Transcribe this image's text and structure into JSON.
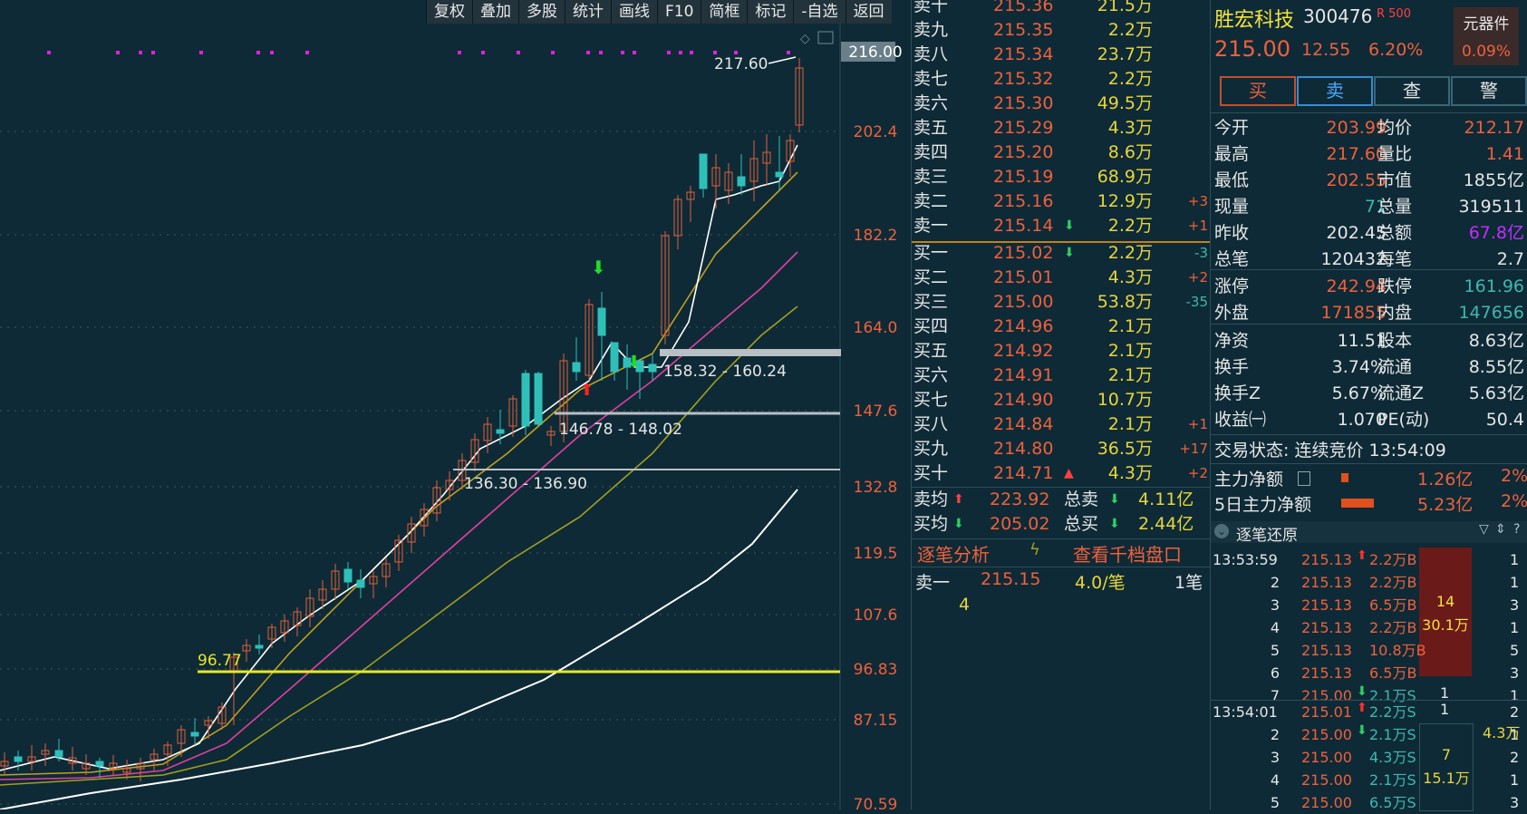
{
  "toolbar": [
    "复权",
    "叠加",
    "多股",
    "统计",
    "画线",
    "F10",
    "简框",
    "标记",
    "-自选",
    "返回"
  ],
  "chart": {
    "price_labels": [
      "216.00",
      "202.4",
      "182.2",
      "164.0",
      "147.6",
      "132.8",
      "119.5",
      "107.6",
      "96.83",
      "87.15",
      "70.59"
    ],
    "annotations": {
      "high": "217.60",
      "zone1": "158.32 - 160.24",
      "zone2": "146.78 - 148.02",
      "zone3": "136.30 - 136.90",
      "support": "96.77"
    }
  },
  "order_book": {
    "sell": [
      {
        "label": "卖十",
        "price": "215.36",
        "vol": "21.5万",
        "chg": ""
      },
      {
        "label": "卖九",
        "price": "215.35",
        "vol": "2.2万",
        "chg": ""
      },
      {
        "label": "卖八",
        "price": "215.34",
        "vol": "23.7万",
        "chg": ""
      },
      {
        "label": "卖七",
        "price": "215.32",
        "vol": "2.2万",
        "chg": ""
      },
      {
        "label": "卖六",
        "price": "215.30",
        "vol": "49.5万",
        "chg": ""
      },
      {
        "label": "卖五",
        "price": "215.29",
        "vol": "4.3万",
        "chg": ""
      },
      {
        "label": "卖四",
        "price": "215.20",
        "vol": "8.6万",
        "chg": ""
      },
      {
        "label": "卖三",
        "price": "215.19",
        "vol": "68.9万",
        "chg": ""
      },
      {
        "label": "卖二",
        "price": "215.16",
        "vol": "12.9万",
        "chg": "+3"
      },
      {
        "label": "卖一",
        "price": "215.14",
        "vol": "2.2万",
        "chg": "+1"
      }
    ],
    "buy": [
      {
        "label": "买一",
        "price": "215.02",
        "vol": "2.2万",
        "chg": "-3"
      },
      {
        "label": "买二",
        "price": "215.01",
        "vol": "4.3万",
        "chg": "+2"
      },
      {
        "label": "买三",
        "price": "215.00",
        "vol": "53.8万",
        "chg": "-35"
      },
      {
        "label": "买四",
        "price": "214.96",
        "vol": "2.1万",
        "chg": ""
      },
      {
        "label": "买五",
        "price": "214.92",
        "vol": "2.1万",
        "chg": ""
      },
      {
        "label": "买六",
        "price": "214.91",
        "vol": "2.1万",
        "chg": ""
      },
      {
        "label": "买七",
        "price": "214.90",
        "vol": "10.7万",
        "chg": ""
      },
      {
        "label": "买八",
        "price": "214.84",
        "vol": "2.1万",
        "chg": "+1"
      },
      {
        "label": "买九",
        "price": "214.80",
        "vol": "36.5万",
        "chg": "+17"
      },
      {
        "label": "买十",
        "price": "214.71",
        "vol": "4.3万",
        "chg": "+2"
      }
    ],
    "sell_avg_label": "卖均",
    "sell_avg": "223.92",
    "total_sell_label": "总卖",
    "total_sell": "4.11亿",
    "buy_avg_label": "买均",
    "buy_avg": "205.02",
    "total_buy_label": "总买",
    "total_buy": "2.44亿",
    "tab_analysis": "逐笔分析",
    "tab_depth": "查看千档盘口",
    "queue_label": "卖一",
    "queue_price": "215.15",
    "queue_per": "4.0/笔",
    "queue_count": "1笔",
    "queue_first": "4"
  },
  "stock": {
    "name": "胜宏科技",
    "code": "300476",
    "tag": "R 500",
    "sector": "元器件",
    "sector_pct": "0.09%",
    "price": "215.00",
    "change": "12.55",
    "pct": "6.20%",
    "buttons": [
      "买",
      "卖",
      "查",
      "警"
    ],
    "stats": [
      [
        "今开",
        "203.99",
        "均价",
        "212.17"
      ],
      [
        "最高",
        "217.60",
        "量比",
        "1.41"
      ],
      [
        "最低",
        "202.55",
        "市值",
        "1855亿"
      ],
      [
        "现量",
        "71",
        "总量",
        "319511"
      ],
      [
        "昨收",
        "202.45",
        "总额",
        "67.8亿"
      ],
      [
        "总笔",
        "120432",
        "每笔",
        "2.7"
      ],
      [
        "涨停",
        "242.94",
        "跌停",
        "161.96"
      ],
      [
        "外盘",
        "171855",
        "内盘",
        "147656"
      ],
      [
        "净资",
        "11.51",
        "股本",
        "8.63亿"
      ],
      [
        "换手",
        "3.74%",
        "流通",
        "8.55亿"
      ],
      [
        "换手Z",
        "5.67%",
        "流通Z",
        "5.63亿"
      ],
      [
        "收益㈠",
        "1.070",
        "PE(动)",
        "50.4"
      ]
    ],
    "trade_status": "交易状态: 连续竞价 13:54:09",
    "main_net_label": "主力净额",
    "main_net": "1.26亿",
    "main_net_pct": "2%",
    "main5_label": "5日主力净额",
    "main5": "5.23亿",
    "main5_pct": "2%",
    "tick_header": "逐笔还原",
    "ticks_a_time": "13:53:59",
    "ticks_a": [
      {
        "n": "",
        "price": "215.13",
        "vol": "2.2万B",
        "right": "1"
      },
      {
        "n": "2",
        "price": "215.13",
        "vol": "2.2万B",
        "right": "1"
      },
      {
        "n": "3",
        "price": "215.13",
        "vol": "6.5万B",
        "right": "3"
      },
      {
        "n": "4",
        "price": "215.13",
        "vol": "2.2万B",
        "right": "1"
      },
      {
        "n": "5",
        "price": "215.13",
        "vol": "10.8万B",
        "right": "5"
      },
      {
        "n": "6",
        "price": "215.13",
        "vol": "6.5万B",
        "right": "3"
      },
      {
        "n": "7",
        "price": "215.00",
        "vol": "2.1万S",
        "right": "1"
      }
    ],
    "ticks_a_box": [
      "14",
      "30.1万"
    ],
    "ticks_a_tail": "1",
    "ticks_b_time": "13:54:01",
    "ticks_b": [
      {
        "n": "",
        "price": "215.01",
        "vol": "2.2万S",
        "right": "2"
      },
      {
        "n": "2",
        "price": "215.00",
        "vol": "2.1万S",
        "right": "1"
      },
      {
        "n": "3",
        "price": "215.00",
        "vol": "4.3万S",
        "right": "2"
      },
      {
        "n": "4",
        "price": "215.00",
        "vol": "2.1万S",
        "right": "1"
      },
      {
        "n": "5",
        "price": "215.00",
        "vol": "6.5万S",
        "right": "3"
      }
    ],
    "ticks_b_one": "1",
    "ticks_b_side": "4.3万",
    "ticks_b_box": [
      "7",
      "15.1万"
    ]
  }
}
